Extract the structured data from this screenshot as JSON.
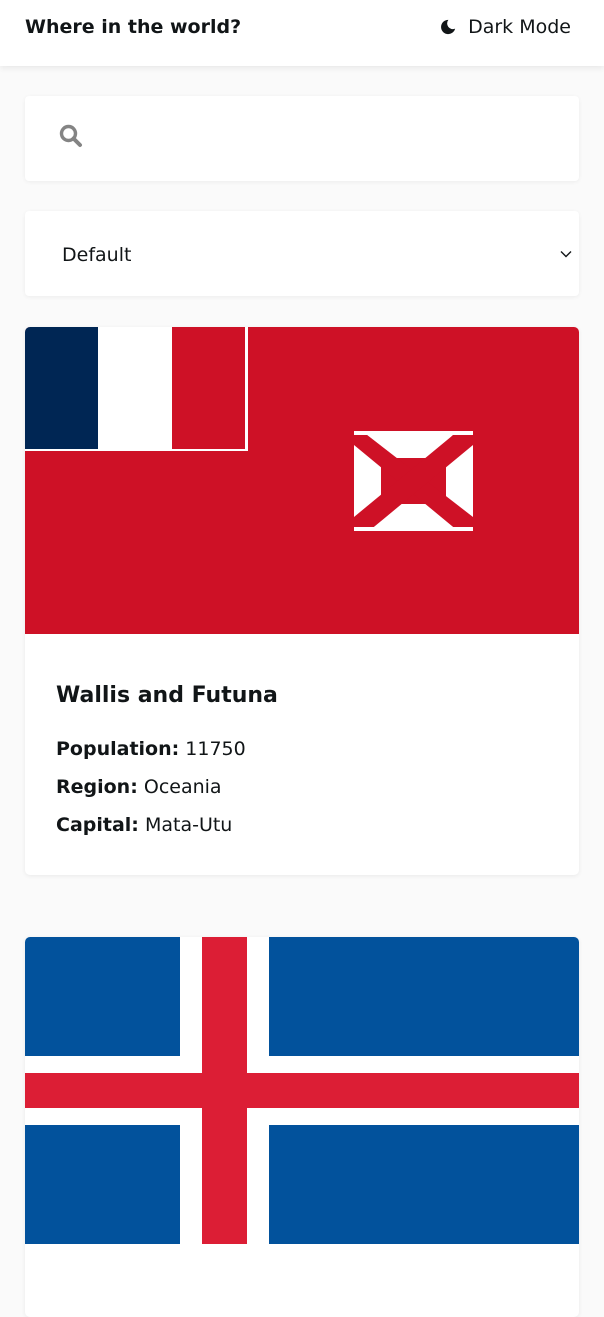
{
  "header": {
    "title": "Where in the world?",
    "dark_mode_label": "Dark Mode",
    "dark_mode_icon": "moon-icon"
  },
  "search": {
    "icon": "search-icon",
    "value": "",
    "placeholder": ""
  },
  "filter": {
    "selected": "Default",
    "icon": "chevron-down-icon"
  },
  "countries": [
    {
      "name": "Wallis and Futuna",
      "population_label": "Population:",
      "population": "11750",
      "region_label": "Region:",
      "region": "Oceania",
      "capital_label": "Capital:",
      "capital": "Mata-Utu",
      "flag_colors": [
        "#ce1126",
        "#002654",
        "#ffffff"
      ]
    },
    {
      "flag_colors": [
        "#02529c",
        "#ffffff",
        "#dc1e35"
      ]
    }
  ],
  "theme": {
    "background": "#fafafa",
    "surface": "#ffffff",
    "text": "#111517"
  }
}
